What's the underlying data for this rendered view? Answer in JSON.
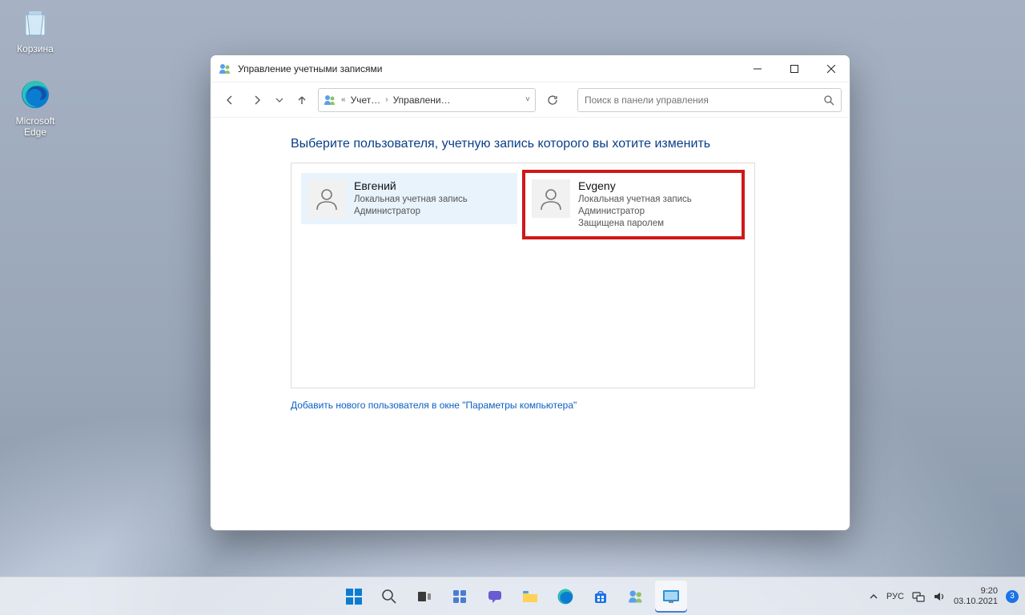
{
  "desktop_icons": {
    "recycle_bin": "Корзина",
    "edge_line1": "Microsoft",
    "edge_line2": "Edge"
  },
  "window": {
    "title": "Управление учетными записями",
    "breadcrumb": {
      "seg1": "Учет…",
      "seg2": "Управлени…"
    },
    "search_placeholder": "Поиск в панели управления",
    "heading": "Выберите пользователя, учетную запись которого вы хотите изменить",
    "users": [
      {
        "name": "Евгений",
        "line1": "Локальная учетная запись",
        "line2": "Администратор",
        "line3": ""
      },
      {
        "name": "Evgeny",
        "line1": "Локальная учетная запись",
        "line2": "Администратор",
        "line3": "Защищена паролем"
      }
    ],
    "add_link": "Добавить нового пользователя в окне \"Параметры компьютера\""
  },
  "taskbar": {
    "lang": "РУС",
    "time": "9:20",
    "date": "03.10.2021",
    "badge": "3"
  }
}
